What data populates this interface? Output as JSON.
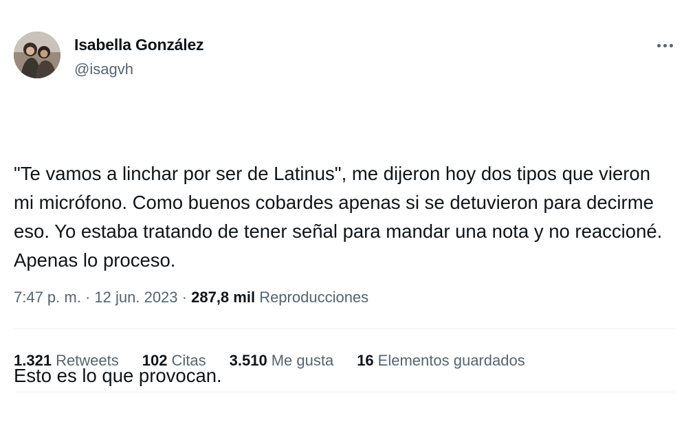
{
  "author": {
    "name": "Isabella González",
    "handle": "@isagvh"
  },
  "tweet": {
    "paragraphs": [
      "\"Te vamos a linchar por ser de Latinus\", me dijeron hoy dos tipos que vieron mi micrófono. Como buenos cobardes apenas si se detuvieron para decirme eso. Yo estaba tratando de tener señal para mandar una nota y no reaccioné. Apenas lo proceso.",
      "Esto es lo que provocan."
    ],
    "time": "7:47 p. m.",
    "separator": "·",
    "date": "12 jun. 2023",
    "views_count": "287,8 mil",
    "views_label": "Reproducciones"
  },
  "stats": [
    {
      "count": "1.321",
      "label": "Retweets"
    },
    {
      "count": "102",
      "label": "Citas"
    },
    {
      "count": "3.510",
      "label": "Me gusta"
    },
    {
      "count": "16",
      "label": "Elementos guardados"
    }
  ],
  "icons": {
    "more": "more-horizontal-icon"
  },
  "colors": {
    "text": "#0f1419",
    "secondary": "#536471",
    "divider": "#eff3f4"
  }
}
